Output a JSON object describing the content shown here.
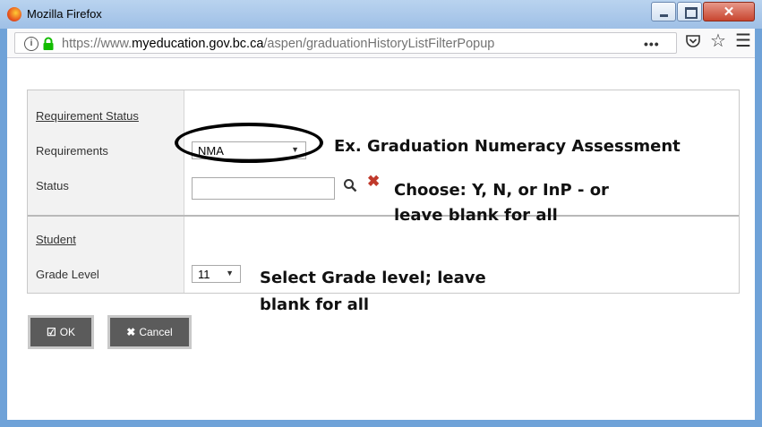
{
  "window": {
    "title": "Mozilla Firefox",
    "close_glyph": "✕"
  },
  "urlbar": {
    "url_prefix": "https://www.",
    "url_domain": "myeducation.gov.bc.ca",
    "url_path": "/aspen/graduationHistoryListFilterPopup",
    "more_glyph": "•••",
    "star_glyph": "☆",
    "menu_glyph": "☰"
  },
  "filter": {
    "requirement_status_heading": "Requirement Status",
    "requirements_label": "Requirements",
    "requirements_value": "NMA",
    "status_label": "Status",
    "status_value": "",
    "student_heading": "Student",
    "grade_level_label": "Grade Level",
    "grade_level_value": "11",
    "caret_glyph": "▼",
    "clear_glyph": "✖"
  },
  "annotations": {
    "requirements_note": "Ex. Graduation Numeracy Assessment",
    "status_note_line1": "Choose: Y, N, or InP - or",
    "status_note_line2": "leave blank for all",
    "grade_note_line1": "Select Grade level; leave",
    "grade_note_line2": "blank for all"
  },
  "buttons": {
    "ok_label": "OK",
    "ok_icon": "☑",
    "cancel_label": "Cancel",
    "cancel_icon": "✖"
  }
}
